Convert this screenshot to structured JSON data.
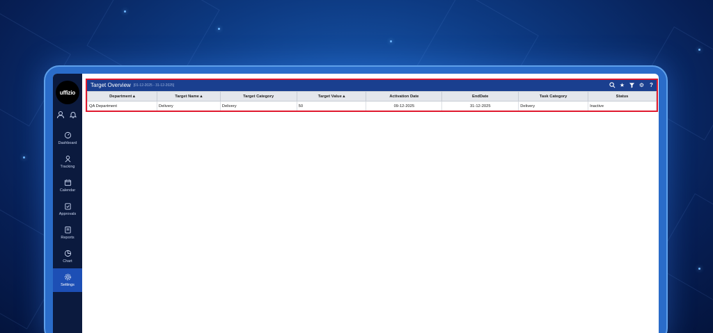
{
  "app": {
    "logo_text": "uffizio"
  },
  "sidebar": {
    "top_icons": [
      "user-icon",
      "bell-icon"
    ],
    "items": [
      {
        "label": "Dashboard",
        "icon": "dashboard-icon"
      },
      {
        "label": "Tracking",
        "icon": "tracking-icon"
      },
      {
        "label": "Calendar",
        "icon": "calendar-icon"
      },
      {
        "label": "Approvals",
        "icon": "approvals-icon"
      },
      {
        "label": "Reports",
        "icon": "reports-icon"
      },
      {
        "label": "Chart",
        "icon": "chart-icon"
      },
      {
        "label": "Settings",
        "icon": "settings-icon",
        "active": true
      }
    ]
  },
  "panel": {
    "title": "Target Overview",
    "date_range": "[01-12-2025 - 31-12-2025]",
    "header_icons": [
      "search-icon",
      "star-icon",
      "filter-icon",
      "gear-icon",
      "help-icon"
    ]
  },
  "table": {
    "columns": [
      "Department ▴",
      "Target Name ▴",
      "Target Category",
      "Target Value ▴",
      "Activation Date",
      "EndDate",
      "Task Category",
      "Status"
    ],
    "rows": [
      [
        "QA Department",
        "Delivery",
        "Delivery",
        "50",
        "09-12-2025",
        "31-12-2025",
        "Delivery",
        "Inactive"
      ]
    ]
  },
  "colors": {
    "sidebar_bg": "#0b1a3e",
    "active_nav": "#1d4fb5",
    "header_bg": "#1a3f8f",
    "highlight_border": "#e0182d"
  }
}
